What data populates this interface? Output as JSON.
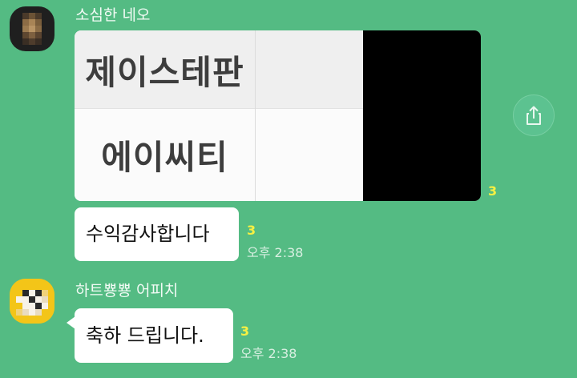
{
  "messages": [
    {
      "sender": "소심한 네오",
      "image": {
        "table_rows": [
          "제이스테판",
          "에이씨티"
        ],
        "unread_count": "3"
      },
      "text": "수익감사합니다",
      "unread_count": "3",
      "time": "오후 2:38"
    },
    {
      "sender": "하트뿅뿅 어피치",
      "text": "축하 드립니다.",
      "unread_count": "3",
      "time": "오후 2:38"
    }
  ],
  "icons": {
    "share": "share-icon",
    "avatar_1": "pixelated-avatar",
    "avatar_2": "apeach-avatar"
  },
  "colors": {
    "background": "#54bb83",
    "bubble": "#ffffff",
    "unread": "#f6f043",
    "avatar_2_bg": "#f3c518"
  }
}
